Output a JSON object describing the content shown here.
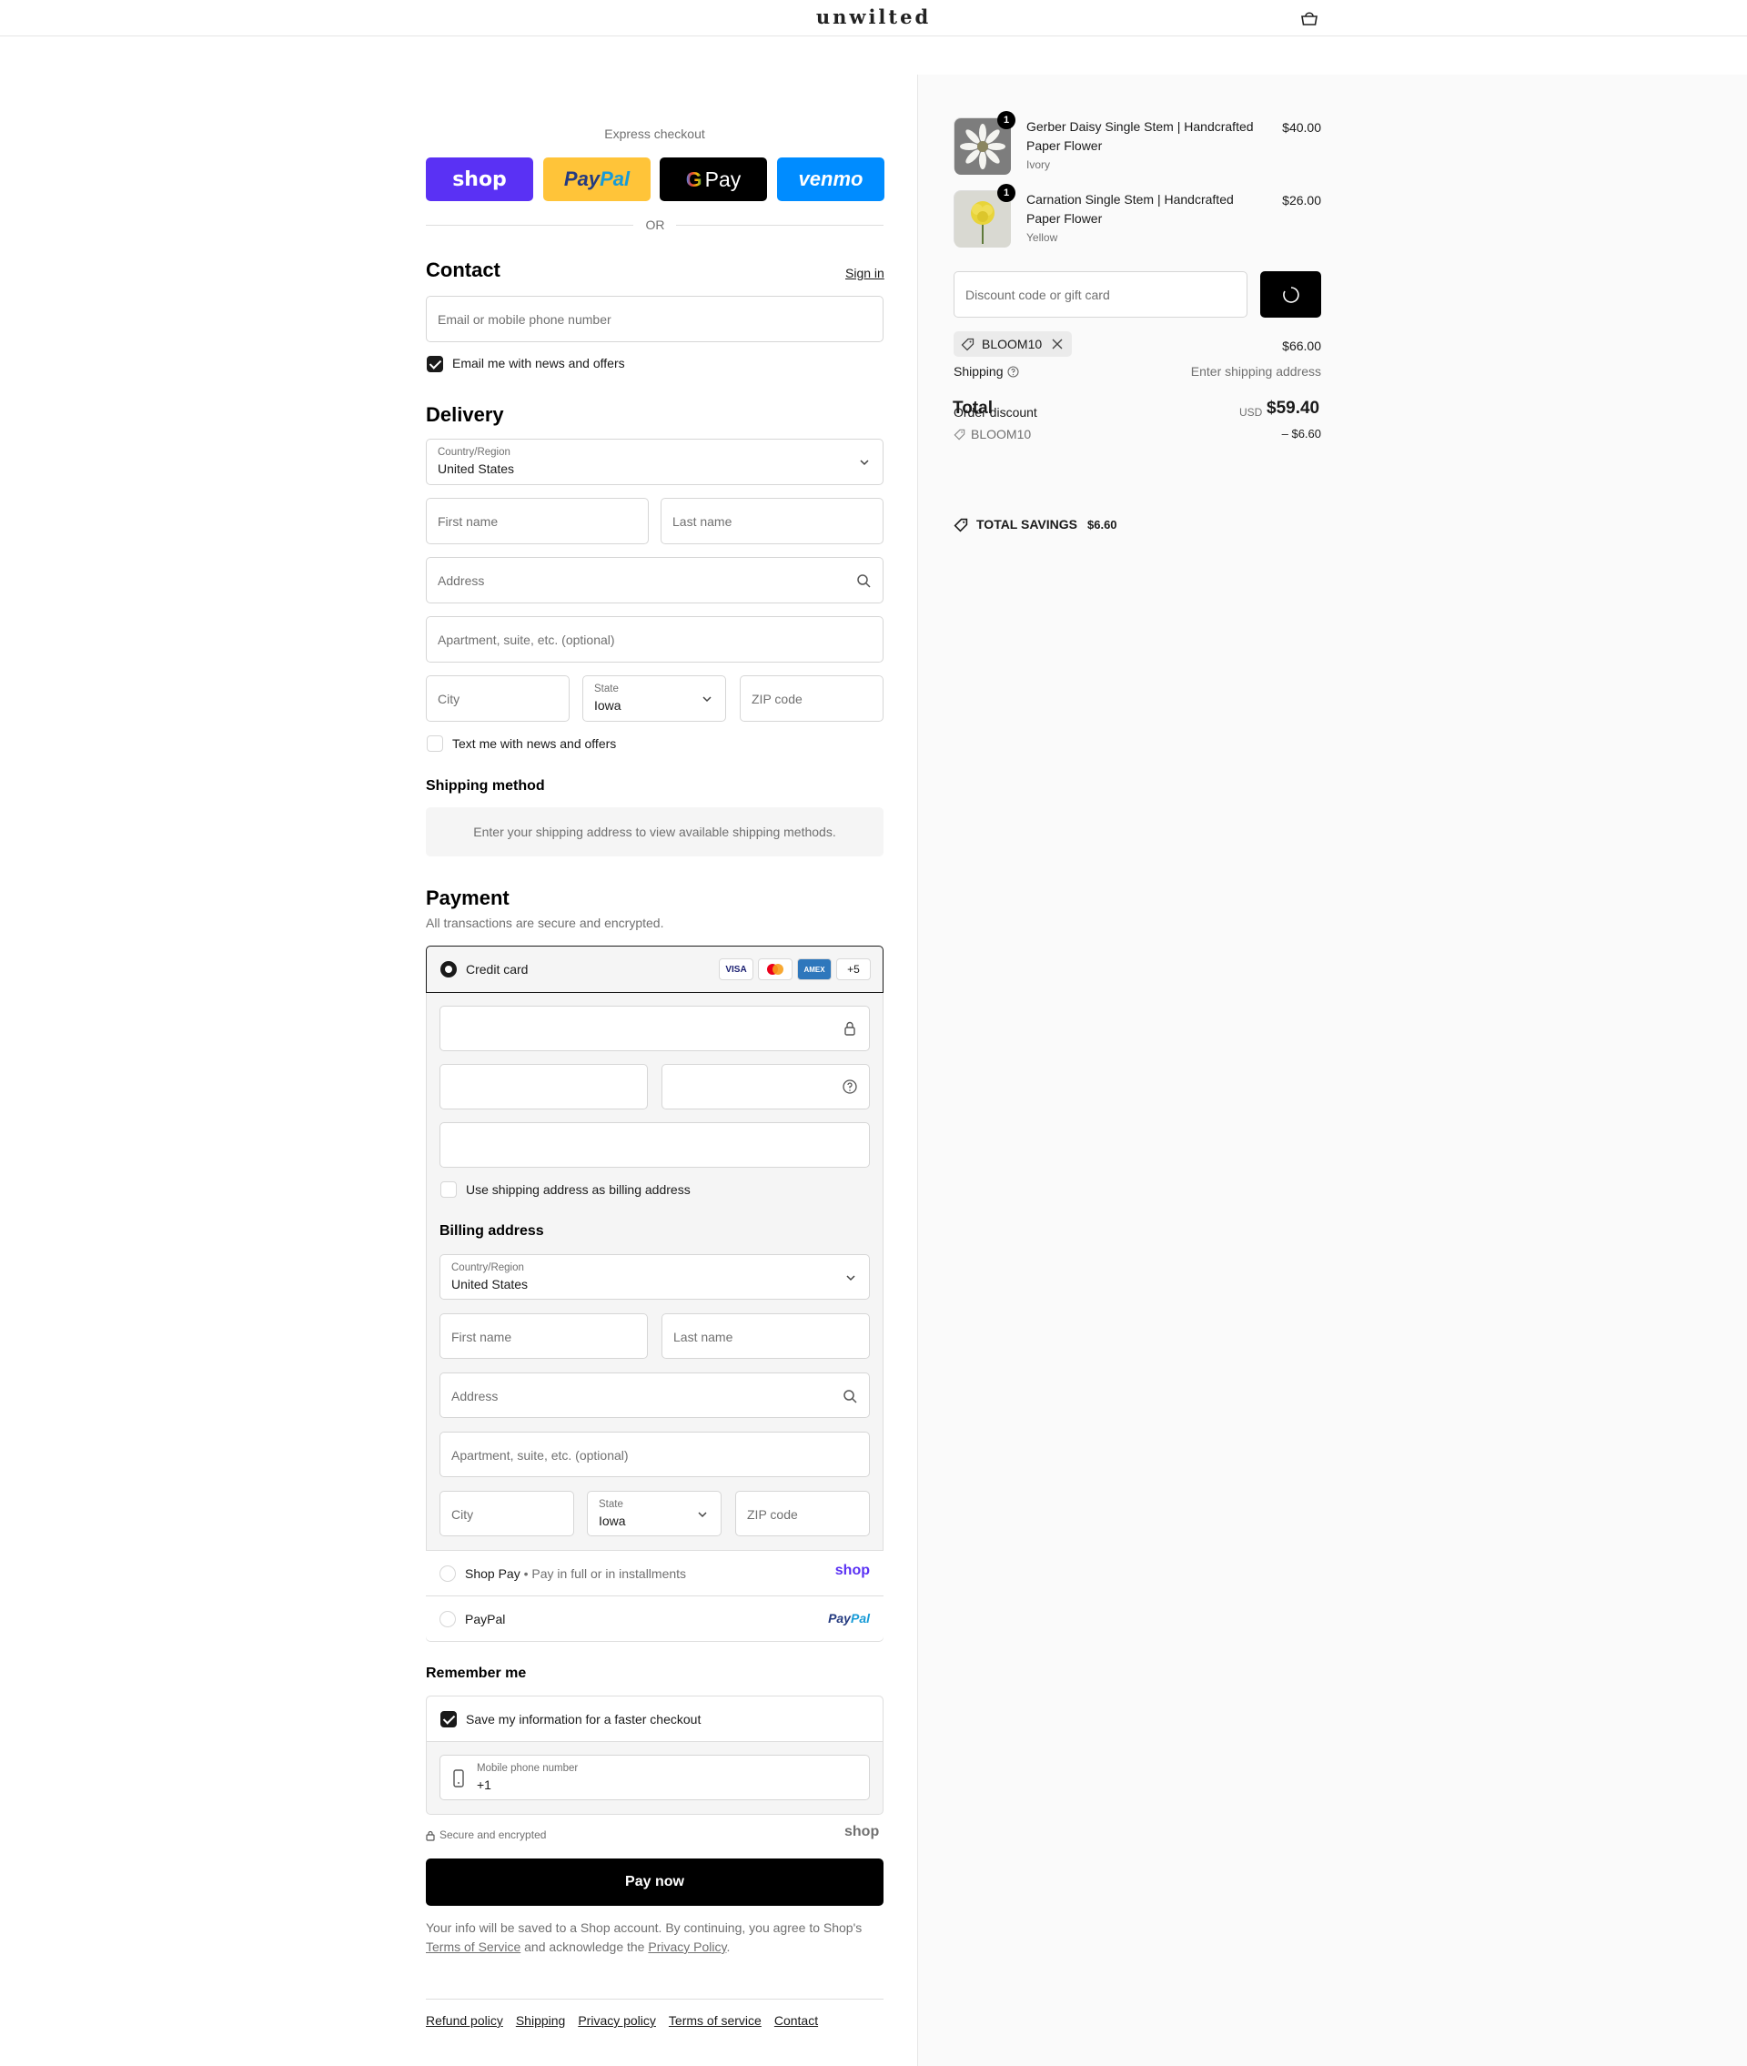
{
  "header": {
    "logo": "unwilted"
  },
  "express": {
    "label": "Express checkout",
    "shop": "shop",
    "paypal_a": "Pay",
    "paypal_b": "Pal",
    "gpay_g": "G",
    "gpay": "Pay",
    "venmo": "venmo",
    "or": "OR"
  },
  "contact": {
    "title": "Contact",
    "sign_in": "Sign in",
    "email_placeholder": "Email or mobile phone number",
    "news_label": "Email me with news and offers"
  },
  "delivery": {
    "title": "Delivery",
    "country_label": "Country/Region",
    "country_value": "United States",
    "first_name": "First name",
    "last_name": "Last name",
    "address": "Address",
    "apartment": "Apartment, suite, etc. (optional)",
    "city": "City",
    "state_label": "State",
    "state_value": "Iowa",
    "zip": "ZIP code",
    "text_label": "Text me with news and offers"
  },
  "shipping_method": {
    "title": "Shipping method",
    "message": "Enter your shipping address to view available shipping methods."
  },
  "payment": {
    "title": "Payment",
    "subtitle": "All transactions are secure and encrypted.",
    "credit_card": "Credit card",
    "cards": [
      "VISA",
      "",
      "AMEX",
      "+5"
    ],
    "use_shipping": "Use shipping address as billing address",
    "billing_title": "Billing address",
    "shop_pay": "Shop Pay",
    "shop_pay_sep": "•",
    "shop_pay_desc": "Pay in full or in installments",
    "shop_logo": "shop",
    "paypal": "PayPal",
    "paypal_logo_a": "Pay",
    "paypal_logo_b": "Pal"
  },
  "remember": {
    "title": "Remember me",
    "save_label": "Save my information for a faster checkout",
    "phone_label": "Mobile phone number",
    "phone_value": "+1",
    "secure": "Secure and encrypted",
    "shop_logo": "shop"
  },
  "pay_now": "Pay now",
  "legal": {
    "text1": "Your info will be saved to a Shop account. By continuing, you agree to Shop's",
    "terms": "Terms of Service",
    "text2": "and acknowledge the",
    "privacy": "Privacy Policy",
    "text3": "."
  },
  "footer_links": [
    "Refund policy",
    "Shipping",
    "Privacy policy",
    "Terms of service",
    "Contact"
  ],
  "order": {
    "items": [
      {
        "qty": "1",
        "name": "Gerber Daisy Single Stem | Handcrafted Paper Flower",
        "variant": "Ivory",
        "price": "$40.00"
      },
      {
        "qty": "1",
        "name": "Carnation Single Stem | Handcrafted Paper Flower",
        "variant": "Yellow",
        "price": "$26.00"
      }
    ],
    "discount_placeholder": "Discount code or gift card",
    "chip_code": "BLOOM10",
    "subtotal": "$66.00",
    "shipping_label": "Shipping",
    "shipping_value": "Enter shipping address",
    "total_label": "Total",
    "order_discount_label": "Order discount",
    "currency": "USD",
    "total_value": "$59.40",
    "discount_code": "BLOOM10",
    "discount_value": "– $6.60",
    "savings_label": "TOTAL SAVINGS",
    "savings_value": "$6.60"
  }
}
